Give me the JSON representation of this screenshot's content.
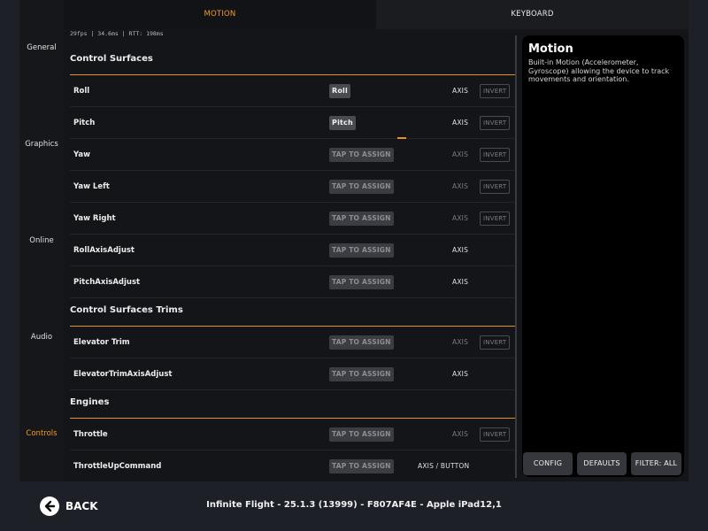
{
  "tabs": [
    {
      "label": "MOTION",
      "active": true
    },
    {
      "label": "KEYBOARD",
      "active": false
    }
  ],
  "sidebar": {
    "items": [
      {
        "label": "General"
      },
      {
        "label": "Graphics"
      },
      {
        "label": "Online"
      },
      {
        "label": "Audio"
      },
      {
        "label": "Controls",
        "active": true
      }
    ]
  },
  "perf_readout": "29fps | 34.6ms | RTT: 198ms",
  "sections": [
    {
      "title": "Control Surfaces",
      "rows": [
        {
          "label": "Roll",
          "assign": "Roll",
          "assigned": true,
          "axis": "AXIS",
          "axis_dim": false,
          "invert": "INVERT"
        },
        {
          "label": "Pitch",
          "assign": "Pitch",
          "assigned": true,
          "axis": "AXIS",
          "axis_dim": false,
          "invert": "INVERT"
        },
        {
          "label": "Yaw",
          "assign": "TAP TO ASSIGN",
          "assigned": false,
          "axis": "AXIS",
          "axis_dim": true,
          "invert": "INVERT"
        },
        {
          "label": "Yaw Left",
          "assign": "TAP TO ASSIGN",
          "assigned": false,
          "axis": "AXIS",
          "axis_dim": true,
          "invert": "INVERT"
        },
        {
          "label": "Yaw Right",
          "assign": "TAP TO ASSIGN",
          "assigned": false,
          "axis": "AXIS",
          "axis_dim": true,
          "invert": "INVERT"
        },
        {
          "label": "RollAxisAdjust",
          "assign": "TAP TO ASSIGN",
          "assigned": false,
          "axis": "AXIS",
          "axis_dim": false,
          "invert": ""
        },
        {
          "label": "PitchAxisAdjust",
          "assign": "TAP TO ASSIGN",
          "assigned": false,
          "axis": "AXIS",
          "axis_dim": false,
          "invert": ""
        }
      ]
    },
    {
      "title": "Control Surfaces Trims",
      "rows": [
        {
          "label": "Elevator Trim",
          "assign": "TAP TO ASSIGN",
          "assigned": false,
          "axis": "AXIS",
          "axis_dim": true,
          "invert": "INVERT"
        },
        {
          "label": "ElevatorTrimAxisAdjust",
          "assign": "TAP TO ASSIGN",
          "assigned": false,
          "axis": "AXIS",
          "axis_dim": false,
          "invert": ""
        }
      ]
    },
    {
      "title": "Engines",
      "rows": [
        {
          "label": "Throttle",
          "assign": "TAP TO ASSIGN",
          "assigned": false,
          "axis": "AXIS",
          "axis_dim": true,
          "invert": "INVERT"
        },
        {
          "label": "ThrottleUpCommand",
          "assign": "TAP TO ASSIGN",
          "assigned": false,
          "axis": "AXIS / BUTTON",
          "axis_dim": false,
          "invert": ""
        }
      ]
    }
  ],
  "info_panel": {
    "title": "Motion",
    "description": "Built-in Motion (Accelerometer, Gyroscope) allowing the device to track movements and orientation."
  },
  "panel_buttons": {
    "config": "CONFIG",
    "defaults": "DEFAULTS",
    "filter": "FILTER: ALL"
  },
  "footer": {
    "back_label": "BACK",
    "version_text": "Infinite Flight - 25.1.3 (13999) - F807AF4E - Apple iPad12,1"
  },
  "colors": {
    "accent": "#f39a24",
    "background": "#1d2026",
    "panel": "#000000"
  },
  "icons": {
    "back": "arrow-left-icon"
  }
}
